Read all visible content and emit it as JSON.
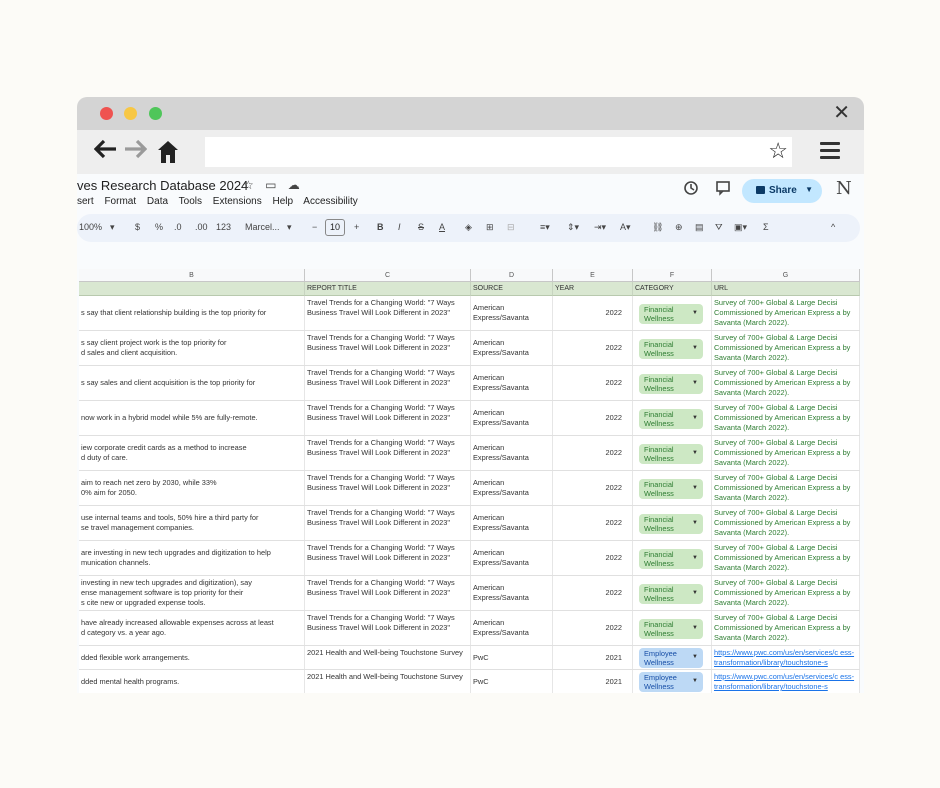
{
  "window": {
    "close_glyph": "✕"
  },
  "browser": {
    "back_glyph": "🡐",
    "forward_glyph": "🡒",
    "star_glyph": "☆",
    "url": ""
  },
  "sheets": {
    "doc_title": "ves Research Database 2024",
    "menus": [
      "sert",
      "Format",
      "Data",
      "Tools",
      "Extensions",
      "Help",
      "Accessibility"
    ],
    "share_label": "Share",
    "logo_letter": "N",
    "toolbar": {
      "zoom": "100%",
      "currency": "$",
      "percent": "%",
      "dec_dec": ".0",
      "dec_inc": ".00",
      "number_format": "123",
      "font": "Marcel...",
      "font_size": "10",
      "minus": "−",
      "plus": "+",
      "bold": "B",
      "italic": "I",
      "strike": "S",
      "text_color": "A",
      "functions": "Σ",
      "collapse": "^"
    },
    "columns": {
      "B": "B",
      "C": "C",
      "D": "D",
      "E": "E",
      "F": "F",
      "G": "G"
    },
    "headers": {
      "B": "",
      "C": "REPORT TITLE",
      "D": "SOURCE",
      "E": "YEAR",
      "F": "CATEGORY",
      "G": "URL"
    },
    "colors": {
      "financial_chip": "#cde8c4",
      "employee_chip": "#bdd9f5",
      "header_row": "#d9e7d1"
    },
    "rows": [
      {
        "b": "s say that client relationship building is the top priority for",
        "c": "Travel Trends for a Changing World: \"7 Ways Business Travel Will Look Different in 2023\"",
        "d": "American Express/Savanta",
        "e": "2022",
        "f": "Financial Wellness",
        "g": "Survey of 700+ Global & Large Decisi Commissioned by American Express a by Savanta (March 2022)."
      },
      {
        "b": "s say client project work is the top priority for\nd sales and client acquisition.",
        "c": "Travel Trends for a Changing World: \"7 Ways Business Travel Will Look Different in 2023\"",
        "d": "American Express/Savanta",
        "e": "2022",
        "f": "Financial Wellness",
        "g": "Survey of 700+ Global & Large Decisi Commissioned by American Express a by Savanta (March 2022)."
      },
      {
        "b": "s say sales and client acquisition is the top priority for",
        "c": "Travel Trends for a Changing World: \"7 Ways Business Travel Will Look Different in 2023\"",
        "d": "American Express/Savanta",
        "e": "2022",
        "f": "Financial Wellness",
        "g": "Survey of 700+ Global & Large Decisi Commissioned by American Express a by Savanta (March 2022)."
      },
      {
        "b": "now work in a hybrid model while 5% are fully-remote.",
        "c": "Travel Trends for a Changing World: \"7 Ways Business Travel Will Look Different in 2023\"",
        "d": "American Express/Savanta",
        "e": "2022",
        "f": "Financial Wellness",
        "g": "Survey of 700+ Global & Large Decisi Commissioned by American Express a by Savanta (March 2022)."
      },
      {
        "b": "iew corporate credit cards as a method to increase\nd duty of care.",
        "c": "Travel Trends for a Changing World: \"7 Ways Business Travel Will Look Different in 2023\"",
        "d": "American Express/Savanta",
        "e": "2022",
        "f": "Financial Wellness",
        "g": "Survey of 700+ Global & Large Decisi Commissioned by American Express a by Savanta (March 2022)."
      },
      {
        "b": "aim to reach net zero by 2030, while 33%\n0% aim for 2050.",
        "c": "Travel Trends for a Changing World: \"7 Ways Business Travel Will Look Different in 2023\"",
        "d": "American Express/Savanta",
        "e": "2022",
        "f": "Financial Wellness",
        "g": "Survey of 700+ Global & Large Decisi Commissioned by American Express a by Savanta (March 2022)."
      },
      {
        "b": "use internal teams and tools, 50% hire a third party for\nse travel management companies.",
        "c": "Travel Trends for a Changing World: \"7 Ways Business Travel Will Look Different in 2023\"",
        "d": "American Express/Savanta",
        "e": "2022",
        "f": "Financial Wellness",
        "g": "Survey of 700+ Global & Large Decisi Commissioned by American Express a by Savanta (March 2022)."
      },
      {
        "b": "are investing in new tech upgrades and digitization to help\nmunication channels.",
        "c": "Travel Trends for a Changing World: \"7 Ways Business Travel Will Look Different in 2023\"",
        "d": "American Express/Savanta",
        "e": "2022",
        "f": "Financial Wellness",
        "g": "Survey of 700+ Global & Large Decisi Commissioned by American Express a by Savanta (March 2022)."
      },
      {
        "b": "investing in new tech upgrades and digitization), say\nense management software is top priority for their\ns cite new or upgraded expense tools.",
        "c": "Travel Trends for a Changing World: \"7 Ways Business Travel Will Look Different in 2023\"",
        "d": "American Express/Savanta",
        "e": "2022",
        "f": "Financial Wellness",
        "g": "Survey of 700+ Global & Large Decisi Commissioned by American Express a by Savanta (March 2022)."
      },
      {
        "b": "have already increased allowable expenses across at least\nd category vs. a year ago.",
        "c": "Travel Trends for a Changing World: \"7 Ways Business Travel Will Look Different in 2023\"",
        "d": "American Express/Savanta",
        "e": "2022",
        "f": "Financial Wellness",
        "g": "Survey of 700+ Global & Large Decisi Commissioned by American Express a by Savanta (March 2022)."
      },
      {
        "b": "dded flexible work arrangements.",
        "c": "2021 Health and Well-being Touchstone Survey",
        "d": "PwC",
        "e": "2021",
        "f": "Employee Wellness",
        "g": "https://www.pwc.com/us/en/services/c ess-transformation/library/touchstone-s"
      },
      {
        "b": "dded mental health programs.",
        "c": "2021 Health and Well-being Touchstone Survey",
        "d": "PwC",
        "e": "2021",
        "f": "Employee Wellness",
        "g": "https://www.pwc.com/us/en/services/c ess-transformation/library/touchstone-s"
      }
    ]
  }
}
